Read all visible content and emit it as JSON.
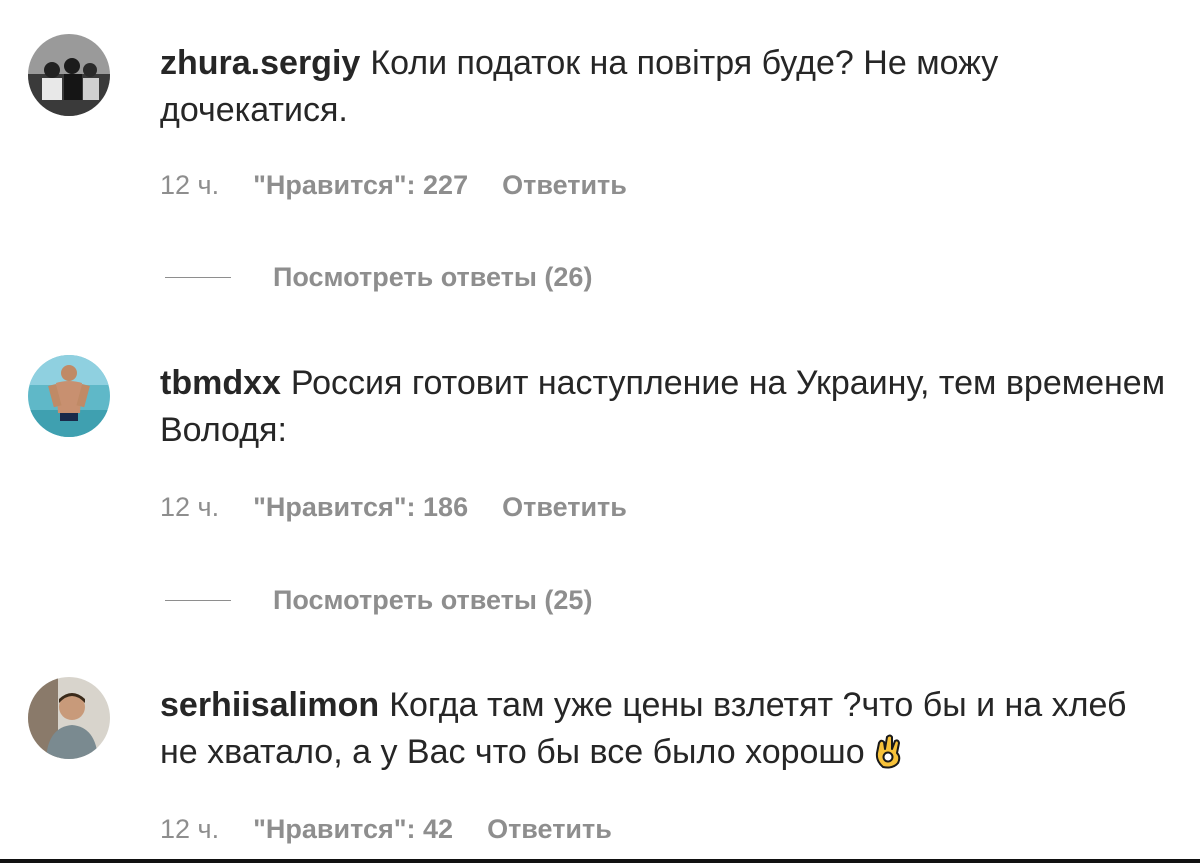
{
  "comments": [
    {
      "username": "zhura.sergiy",
      "text": "Коли податок на повітря буде? Не можу дочекатися.",
      "time": "12 ч.",
      "likes": "\"Нравится\": 227",
      "reply": "Ответить",
      "view_replies": "Посмотреть ответы (26)"
    },
    {
      "username": "tbmdxx",
      "text": "Россия готовит наступление на Украину, тем временем Володя:",
      "time": "12 ч.",
      "likes": "\"Нравится\": 186",
      "reply": "Ответить",
      "view_replies": "Посмотреть ответы (25)"
    },
    {
      "username": "serhiisalimon",
      "text": "Когда там уже цены взлетят ?что бы и на хлеб не хватало, а у Вас что бы все было хорошо",
      "emoji_icon": "ok-hand-emoji",
      "time": "12 ч.",
      "likes": "\"Нравится\": 42",
      "reply": "Ответить"
    }
  ]
}
